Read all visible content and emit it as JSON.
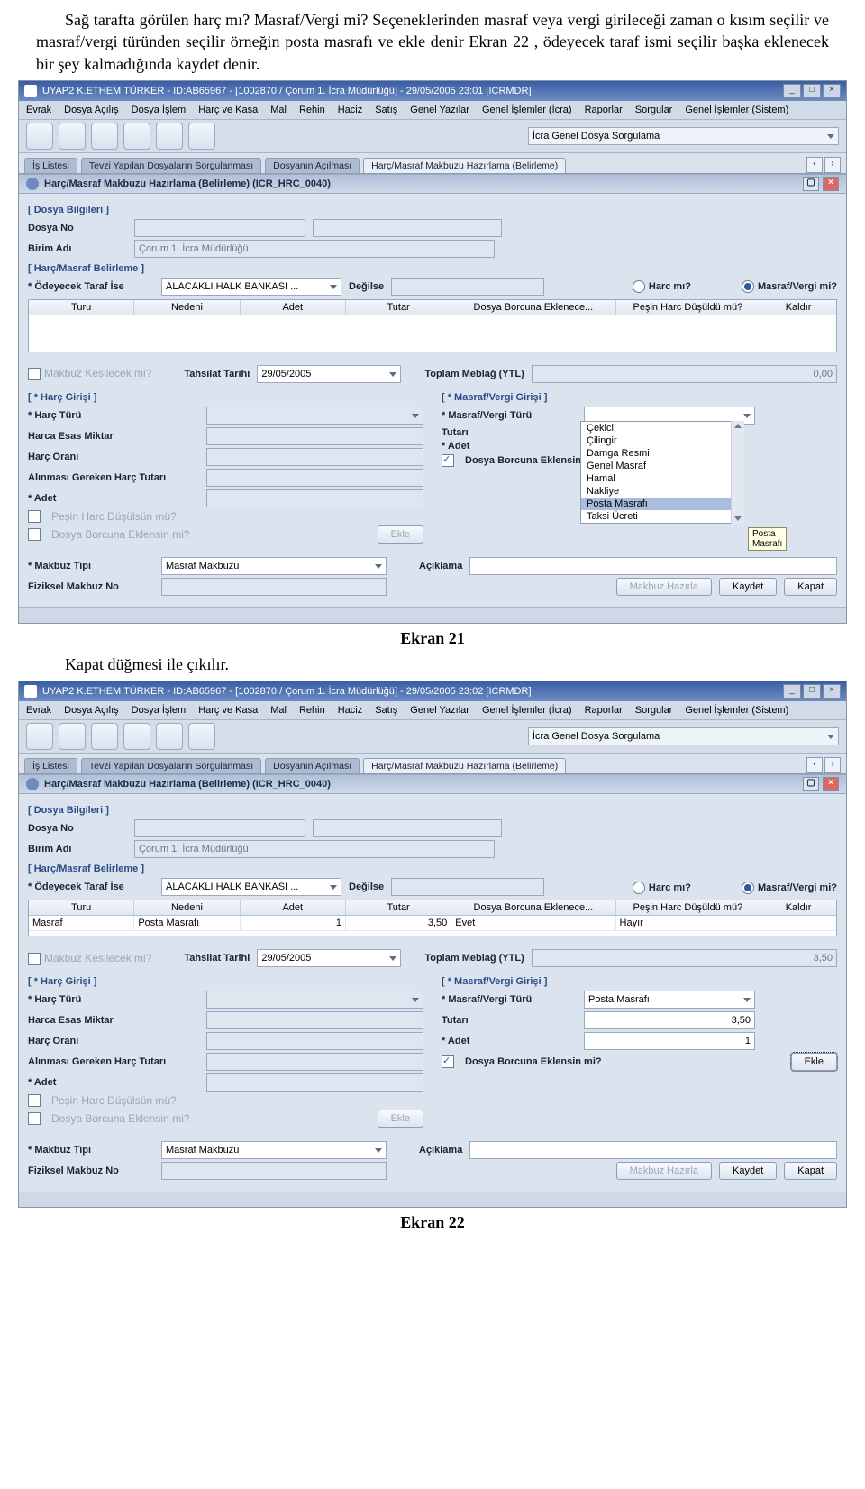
{
  "para1": "Sağ tarafta görülen harç mı? Masraf/Vergi mi? Seçeneklerinden masraf veya vergi girileceği zaman o kısım seçilir ve masraf/vergi türünden seçilir örneğin posta masrafı ve ekle denir Ekran 22 , ödeyecek taraf ismi seçilir başka eklenecek bir şey kalmadığında kaydet denir.",
  "titlebar1": "UYAP2   K.ETHEM TÜRKER - ID:AB65967 - [1002870 / Çorum 1. İcra Müdürlüğü] - 29/05/2005 23:01 [ICRMDR]",
  "titlebar2": "UYAP2   K.ETHEM TÜRKER - ID:AB65967 - [1002870 / Çorum 1. İcra Müdürlüğü] - 29/05/2005 23:02 [ICRMDR]",
  "menu": {
    "m1": "Evrak",
    "m2": "Dosya Açılış",
    "m3": "Dosya İşlem",
    "m4": "Harç ve Kasa",
    "m5": "Mal",
    "m6": "Rehin",
    "m7": "Haciz",
    "m8": "Satış",
    "m9": "Genel Yazılar",
    "m10": "Genel İşlemler (İcra)",
    "m11": "Raporlar",
    "m12": "Sorgular",
    "m13": "Genel İşlemler (Sistem)"
  },
  "combo_top": "İcra Genel Dosya Sorgulama",
  "tabs": {
    "t1": "İş Listesi",
    "t2": "Tevzi Yapılan Dosyaların Sorgulanması",
    "t3": "Dosyanın Açılması",
    "t4": "Harç/Masraf Makbuzu Hazırlama (Belirleme)"
  },
  "panel_title": "Harç/Masraf Makbuzu Hazırlama (Belirleme) (ICR_HRC_0040)",
  "grp_dosya": "[ Dosya Bilgileri ]",
  "lbl_dosyano": "Dosya No",
  "lbl_birim": "Birim Adı",
  "val_birim": "Çorum 1. İcra Müdürlüğü",
  "grp_harc": "[ Harç/Masraf Belirleme ]",
  "lbl_odeyecek": "* Ödeyecek Taraf İse",
  "val_odeyecek": "ALACAKLI HALK BANKASI ...",
  "lbl_degilse": "Değilse",
  "lbl_harcmi": "Harc mı?",
  "lbl_masrafmi": "Masraf/Vergi mi?",
  "th": {
    "c1": "Turu",
    "c2": "Nedeni",
    "c3": "Adet",
    "c4": "Tutar",
    "c5": "Dosya Borcuna Eklenece...",
    "c6": "Peşin Harc Düşüldü mü?",
    "c7": "Kaldır"
  },
  "row2": {
    "c1": "Masraf",
    "c2": "Posta Masrafı",
    "c3": "1",
    "c4": "3,50",
    "c5": "Evet",
    "c6": "Hayır"
  },
  "lbl_makbuzkes": "Makbuz Kesilecek mi?",
  "lbl_tahsilat": "Tahsilat Tarihi",
  "val_tahsilat": "29/05/2005",
  "lbl_toplam": "Toplam Meblağ (YTL)",
  "val_toplam1": "0,00",
  "val_toplam2": "3,50",
  "grp_harcgir": "[ * Harç Girişi ]",
  "lbl_harcturu": "* Harç Türü",
  "lbl_harcaesas": "Harca Esas Miktar",
  "lbl_harcoran": "Harç Oranı",
  "lbl_alinmasi": "Alınması Gereken Harç Tutarı",
  "lbl_adet": "* Adet",
  "lbl_pesin": "Peşin Harc Düşülsün mü?",
  "lbl_dosyaborc": "Dosya Borcuna Eklensin mi?",
  "btn_ekle": "Ekle",
  "grp_masrafgir": "[ * Masraf/Vergi Girişi ]",
  "lbl_masrafturu": "* Masraf/Vergi Türü",
  "lbl_tutari": "Tutarı",
  "list": {
    "i1": "Çekici",
    "i2": "Çilingir",
    "i3": "Damga Resmi",
    "i4": "Genel Masraf",
    "i5": "Hamal",
    "i6": "Nakliye",
    "i7": "Posta Masrafı",
    "i8": "Taksi Ücreti"
  },
  "tooltip_posta": "Posta Masrafı",
  "lbl_makbuztipi": "* Makbuz Tipi",
  "val_makbuztipi": "Masraf Makbuzu",
  "lbl_fiziksel": "Fiziksel Makbuz No",
  "lbl_aciklama": "Açıklama",
  "btn_makbuzhaz": "Makbuz Hazırla",
  "btn_kaydet": "Kaydet",
  "btn_kapat": "Kapat",
  "caption1": "Ekran 21",
  "para2": "Kapat düğmesi ile çıkılır.",
  "val_masrafturu2": "Posta Masrafı",
  "val_tutari2": "3,50",
  "val_adet2": "1",
  "caption2": "Ekran 22"
}
